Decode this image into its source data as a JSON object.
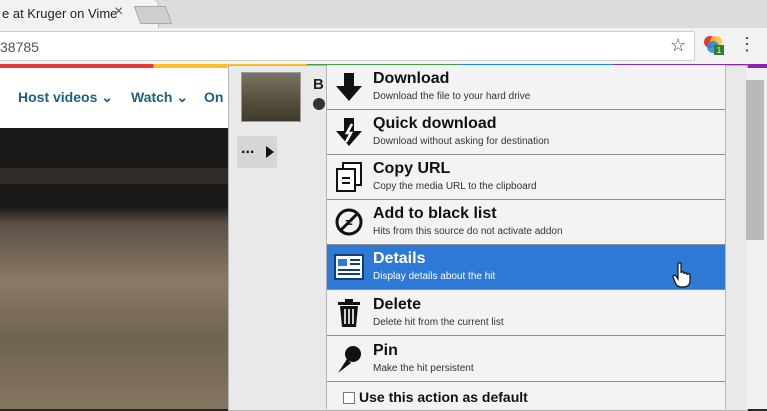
{
  "browser": {
    "tab_title": "e at Kruger on Vime",
    "tab_close": "×",
    "address_text": "38785",
    "star": "☆",
    "kebab": "⋮",
    "extension_badge": "1"
  },
  "site_nav": {
    "items": [
      "Host videos ⌄",
      "Watch ⌄",
      "On"
    ]
  },
  "panel": {
    "thumb_title": "B",
    "more_label": "..."
  },
  "menu": {
    "items": [
      {
        "icon": "download-arrow-icon",
        "label": "Download",
        "desc": "Download the file to your hard drive"
      },
      {
        "icon": "quick-download-icon",
        "label": "Quick download",
        "desc": "Download without asking for destination"
      },
      {
        "icon": "copy-document-icon",
        "label": "Copy URL",
        "desc": "Copy the media URL to the clipboard"
      },
      {
        "icon": "block-icon",
        "label": "Add to black list",
        "desc": "Hits from this source do not activate addon"
      },
      {
        "icon": "details-icon",
        "label": "Details",
        "desc": "Display details about the hit",
        "selected": true
      },
      {
        "icon": "trash-icon",
        "label": "Delete",
        "desc": "Delete hit from the current list"
      },
      {
        "icon": "pin-icon",
        "label": "Pin",
        "desc": "Make the hit persistent"
      }
    ],
    "footer_label": "Use this action as default",
    "default_checked": false
  },
  "colors": {
    "selected": "#2f79d6",
    "nav_text": "#1f5f80"
  }
}
